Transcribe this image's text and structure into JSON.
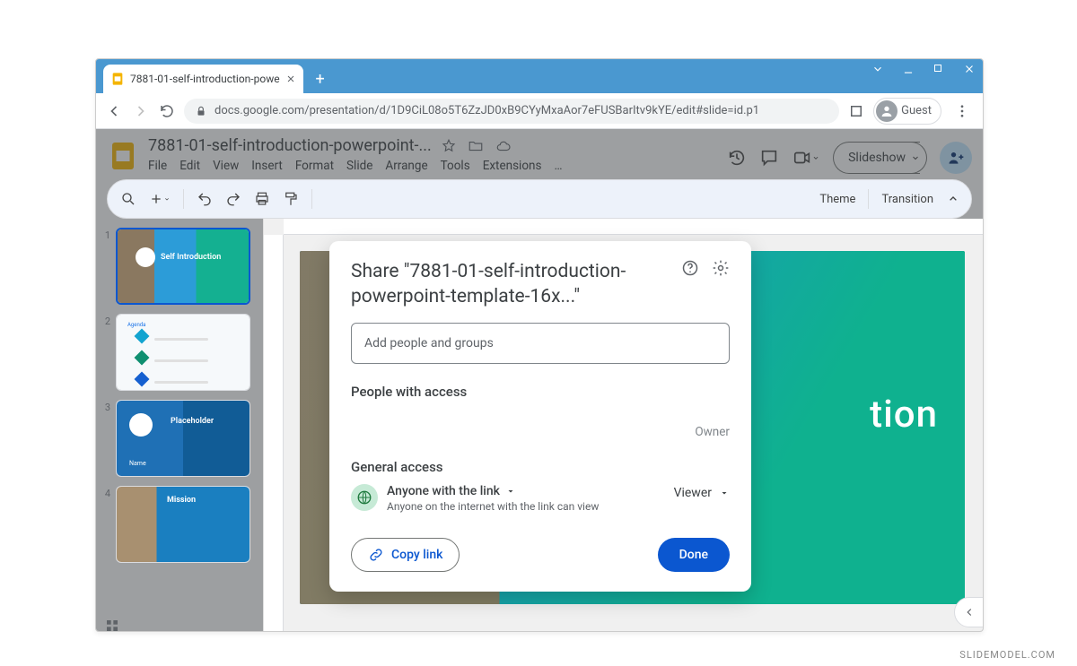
{
  "browser": {
    "tab_title": "7881-01-self-introduction-powe",
    "url_display": "docs.google.com/presentation/d/1D9CiL08o5T6ZzJD0xB9CYyMxaAor7eFUSBarItv9kYE/edit#slide=id.p1",
    "guest_label": "Guest"
  },
  "app": {
    "doc_title": "7881-01-self-introduction-powerpoint-...",
    "menus": [
      "File",
      "Edit",
      "View",
      "Insert",
      "Format",
      "Slide",
      "Arrange",
      "Tools",
      "Extensions",
      "…"
    ],
    "slideshow_label": "Slideshow",
    "toolbar_right": {
      "theme": "Theme",
      "transition": "Transition"
    }
  },
  "thumbs": [
    {
      "num": "1",
      "title": "Self Introduction"
    },
    {
      "num": "2",
      "title": "Agenda"
    },
    {
      "num": "3",
      "title": "Placeholder",
      "name": "Name"
    },
    {
      "num": "4",
      "title": "Mission"
    }
  ],
  "slide": {
    "title_fragment": "tion"
  },
  "dialog": {
    "title": "Share \"7881-01-self-introduction-powerpoint-template-16x...\"",
    "add_placeholder": "Add people and groups",
    "people_heading": "People with access",
    "owner_label": "Owner",
    "general_heading": "General access",
    "link_scope": "Anyone with the link",
    "link_sub": "Anyone on the internet with the link can view",
    "role": "Viewer",
    "copy_link": "Copy link",
    "done": "Done"
  },
  "watermark": "SLIDEMODEL.COM"
}
